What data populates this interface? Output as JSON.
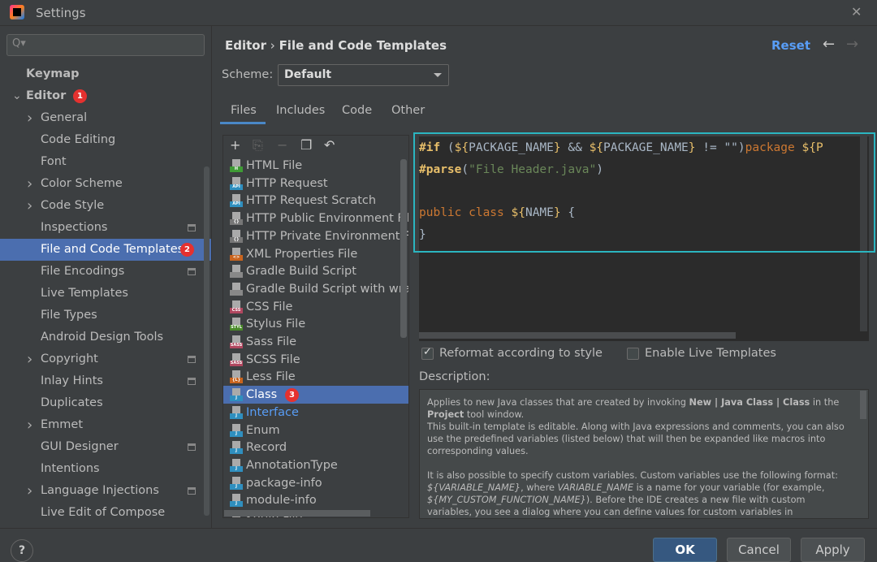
{
  "window": {
    "title": "Settings",
    "close": "✕"
  },
  "sidebar": {
    "search_placeholder": "Q▾",
    "items": [
      {
        "label": "Keymap",
        "level": 0,
        "bold": true
      },
      {
        "label": "Editor",
        "level": 0,
        "bold": true,
        "expanded": true,
        "badge": "1"
      },
      {
        "label": "General",
        "level": 1,
        "chevron": true
      },
      {
        "label": "Code Editing",
        "level": 1
      },
      {
        "label": "Font",
        "level": 1
      },
      {
        "label": "Color Scheme",
        "level": 1,
        "chevron": true
      },
      {
        "label": "Code Style",
        "level": 1,
        "chevron": true
      },
      {
        "label": "Inspections",
        "level": 1,
        "gear": true
      },
      {
        "label": "File and Code Templates",
        "level": 1,
        "gear": true,
        "selected": true,
        "badge": "2"
      },
      {
        "label": "File Encodings",
        "level": 1,
        "gear": true
      },
      {
        "label": "Live Templates",
        "level": 1
      },
      {
        "label": "File Types",
        "level": 1
      },
      {
        "label": "Android Design Tools",
        "level": 1
      },
      {
        "label": "Copyright",
        "level": 1,
        "chevron": true,
        "gear": true
      },
      {
        "label": "Inlay Hints",
        "level": 1,
        "gear": true
      },
      {
        "label": "Duplicates",
        "level": 1
      },
      {
        "label": "Emmet",
        "level": 1,
        "chevron": true
      },
      {
        "label": "GUI Designer",
        "level": 1,
        "gear": true
      },
      {
        "label": "Intentions",
        "level": 1
      },
      {
        "label": "Language Injections",
        "level": 1,
        "chevron": true,
        "gear": true
      },
      {
        "label": "Live Edit of Compose Literals",
        "level": 1
      }
    ]
  },
  "header": {
    "breadcrumb_parent": "Editor",
    "breadcrumb_sep": "›",
    "breadcrumb_current": "File and Code Templates",
    "reset": "Reset",
    "back": "←",
    "forward": "→"
  },
  "scheme": {
    "label": "Scheme:",
    "value": "Default"
  },
  "tabs": [
    {
      "label": "Files",
      "active": true
    },
    {
      "label": "Includes"
    },
    {
      "label": "Code"
    },
    {
      "label": "Other"
    }
  ],
  "toolbar": [
    "+",
    "⎘",
    "−",
    "❐",
    "↶"
  ],
  "templates": [
    {
      "label": "HTML File",
      "tag": "H",
      "color": "#3f9b35"
    },
    {
      "label": "HTTP Request",
      "tag": "API",
      "color": "#2f8fbf"
    },
    {
      "label": "HTTP Request Scratch",
      "tag": "API",
      "color": "#2f8fbf"
    },
    {
      "label": "HTTP Public Environment File",
      "tag": "{}",
      "color": "#777777"
    },
    {
      "label": "HTTP Private Environment File",
      "tag": "{}",
      "color": "#777777"
    },
    {
      "label": "XML Properties File",
      "tag": "<>",
      "color": "#c9641e"
    },
    {
      "label": "Gradle Build Script",
      "tag": "",
      "color": "#888888"
    },
    {
      "label": "Gradle Build Script with wrapp",
      "tag": "",
      "color": "#888888"
    },
    {
      "label": "CSS File",
      "tag": "CSS",
      "color": "#b0475f"
    },
    {
      "label": "Stylus File",
      "tag": "STYL",
      "color": "#4a8a2a"
    },
    {
      "label": "Sass File",
      "tag": "SASS",
      "color": "#b0475f"
    },
    {
      "label": "SCSS File",
      "tag": "SASS",
      "color": "#b0475f"
    },
    {
      "label": "Less File",
      "tag": "{L}",
      "color": "#c9641e"
    },
    {
      "label": "Class",
      "tag": "J",
      "color": "#2f8fbf",
      "selected": true,
      "badge": "3"
    },
    {
      "label": "Interface",
      "tag": "J",
      "color": "#2f8fbf",
      "link": true
    },
    {
      "label": "Enum",
      "tag": "J",
      "color": "#2f8fbf"
    },
    {
      "label": "Record",
      "tag": "J",
      "color": "#2f8fbf"
    },
    {
      "label": "AnnotationType",
      "tag": "J",
      "color": "#2f8fbf"
    },
    {
      "label": "package-info",
      "tag": "J",
      "color": "#2f8fbf"
    },
    {
      "label": "module-info",
      "tag": "J",
      "color": "#2f8fbf"
    },
    {
      "label": "Kotlin File",
      "tag": "K",
      "color": "#7f52ff"
    }
  ],
  "code": {
    "l1a": "#if",
    "l1b": " (",
    "l1c": "${",
    "l1d": "PACKAGE_NAME",
    "l1e": "}",
    " l1f": "",
    "l1g": " && ",
    "l1h": "${",
    "l1i": "PACKAGE_NAME",
    "l1j": "}",
    "l1k": " != \"\")",
    "l1l": "package ",
    "l1m": "${P",
    "l2a": "#parse",
    "l2b": "(",
    "l2c": "\"File Header.java\"",
    "l2d": ")",
    "l4a": "public class ",
    "l4b": "${",
    "l4c": "NAME",
    "l4d": "}",
    "l4e": " {",
    "l5": "}"
  },
  "options": {
    "reformat": "Reformat according to style",
    "reformat_checked": true,
    "live": "Enable Live Templates",
    "live_checked": false
  },
  "description": {
    "label": "Description:",
    "p1a": "Applies to new Java classes that are created by invoking ",
    "p1b": "New | Java Class | Class",
    "p1c": " in the ",
    "p1d": "Project",
    "p1e": " tool window.",
    "p1f": "This built-in template is editable. Along with Java expressions and comments, you can also use the predefined variables (listed below) that will then be expanded like macros into corresponding values.",
    "p2a": "It is also possible to specify custom variables. Custom variables use the following format: ",
    "p2b": "${VARIABLE_NAME}",
    "p2c": ", where ",
    "p2d": "VARIABLE_NAME",
    "p2e": " is a name for your variable (for example, ",
    "p2f": "${MY_CUSTOM_FUNCTION_NAME}",
    "p2g": "). Before the IDE creates a new file with custom variables, you see a dialog where you can define values for custom variables in"
  },
  "footer": {
    "help": "?",
    "ok": "OK",
    "cancel": "Cancel",
    "apply": "Apply"
  },
  "colors": {
    "selection": "#4b6eaf",
    "highlight_border": "#2bb5c0",
    "link": "#589df6",
    "badge": "#e5312f"
  }
}
